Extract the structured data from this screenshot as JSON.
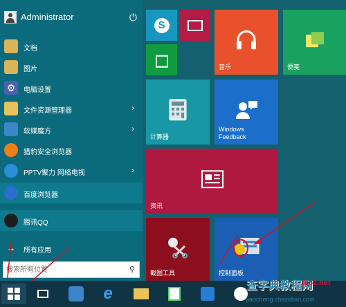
{
  "start_menu": {
    "user_name": "Administrator",
    "items": [
      {
        "label": "文档",
        "icon": "folder-icon",
        "color": "#d9b45a",
        "arrow": ""
      },
      {
        "label": "图片",
        "icon": "folder-icon",
        "color": "#d9b45a",
        "arrow": ""
      },
      {
        "label": "电脑设置",
        "icon": "gear-icon",
        "color": "#4b5fb0",
        "arrow": ""
      },
      {
        "label": "文件资源管理器",
        "icon": "folder-icon",
        "color": "#e8c25a",
        "arrow": "›"
      },
      {
        "label": "软媒魔方",
        "icon": "cube-icon",
        "color": "#3a86c8",
        "arrow": "›"
      },
      {
        "label": "猎豹安全浏览器",
        "icon": "browser-icon",
        "color": "#f07f18",
        "arrow": ""
      },
      {
        "label": "PPTV聚力 网络电视",
        "icon": "pptv-icon",
        "color": "#2b8fd8",
        "arrow": "›"
      },
      {
        "label": "百度浏览器",
        "icon": "browser-icon",
        "color": "#2a6fd0",
        "arrow": ""
      },
      {
        "label": "腾讯QQ",
        "icon": "qq-icon",
        "color": "#1c1c1c",
        "arrow": ""
      },
      {
        "label": "所有应用",
        "icon": "arrow-right-icon",
        "color": "",
        "arrow": ""
      }
    ],
    "search_placeholder": "搜索所有位置"
  },
  "tiles": {
    "music": "音乐",
    "sticky": "便笺",
    "calculator": "计算器",
    "feedback": "Windows\nFeedback",
    "news": "资讯",
    "snipping": "截图工具",
    "control_panel": "控制面板"
  },
  "watermark": {
    "site": "查字典",
    "site2": "教程网",
    "domain": "jb51.net",
    "url": "jiaocheng.chazidian.com"
  },
  "colors": {
    "panel": "#0b6a7c",
    "background": "#14606e",
    "music_tile": "#e8512c",
    "sticky_tile": "#19a25f",
    "calc_tile": "#1897a6",
    "feedback_tile": "#1b6fcb",
    "news_tile": "#b0193f",
    "snip_tile": "#8d0f1e",
    "control_tile": "#1a5fb4"
  }
}
